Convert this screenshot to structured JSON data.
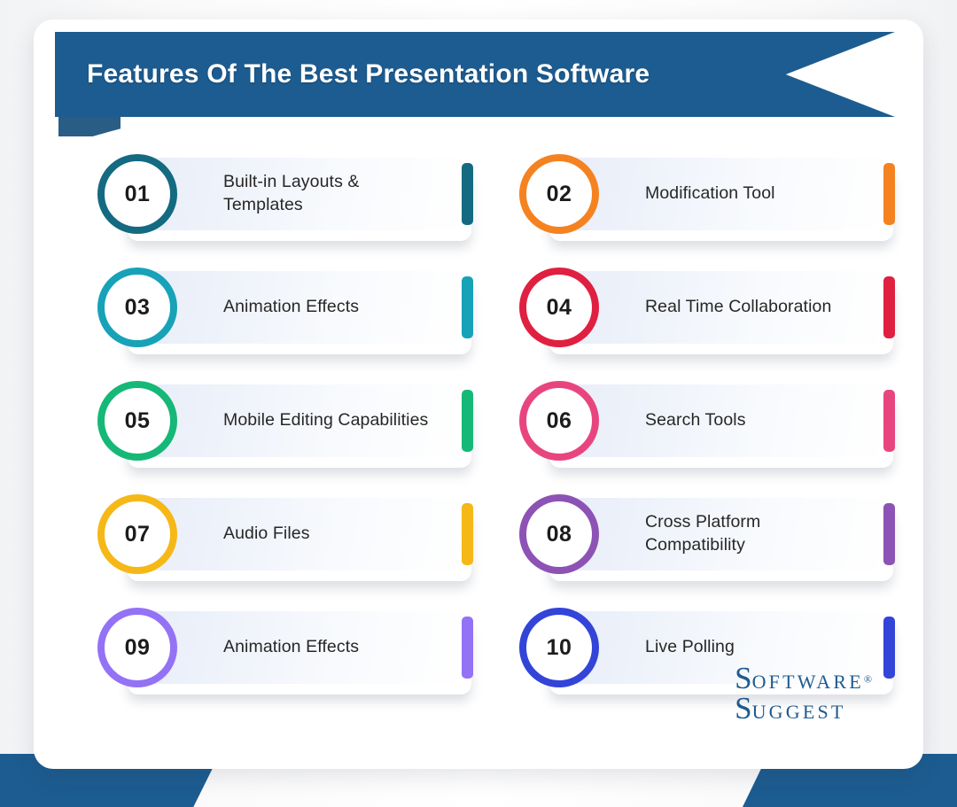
{
  "header": {
    "title": "Features Of The Best Presentation Software"
  },
  "features": [
    {
      "number": "01",
      "label": "Built-in Layouts & Templates",
      "color": "#146a80"
    },
    {
      "number": "02",
      "label": "Modification Tool",
      "color": "#f58220"
    },
    {
      "number": "03",
      "label": "Animation Effects",
      "color": "#17a2b8"
    },
    {
      "number": "04",
      "label": "Real Time Collaboration",
      "color": "#e02040"
    },
    {
      "number": "05",
      "label": "Mobile Editing Capabilities",
      "color": "#16b877"
    },
    {
      "number": "06",
      "label": "Search Tools",
      "color": "#e8457f"
    },
    {
      "number": "07",
      "label": "Audio Files",
      "color": "#f5b817"
    },
    {
      "number": "08",
      "label": "Cross Platform Compatibility",
      "color": "#8c53b5"
    },
    {
      "number": "09",
      "label": "Animation Effects",
      "color": "#9472f5"
    },
    {
      "number": "10",
      "label": "Live Polling",
      "color": "#3344d8"
    }
  ],
  "logo": {
    "line1_cap": "S",
    "line1_rest": "OFTWARE",
    "registered": "®",
    "line2_cap": "S",
    "line2_rest": "UGGEST"
  },
  "colors": {
    "brand_blue": "#1d5c90",
    "card_background": "#ffffff",
    "text_dark": "#272727"
  }
}
